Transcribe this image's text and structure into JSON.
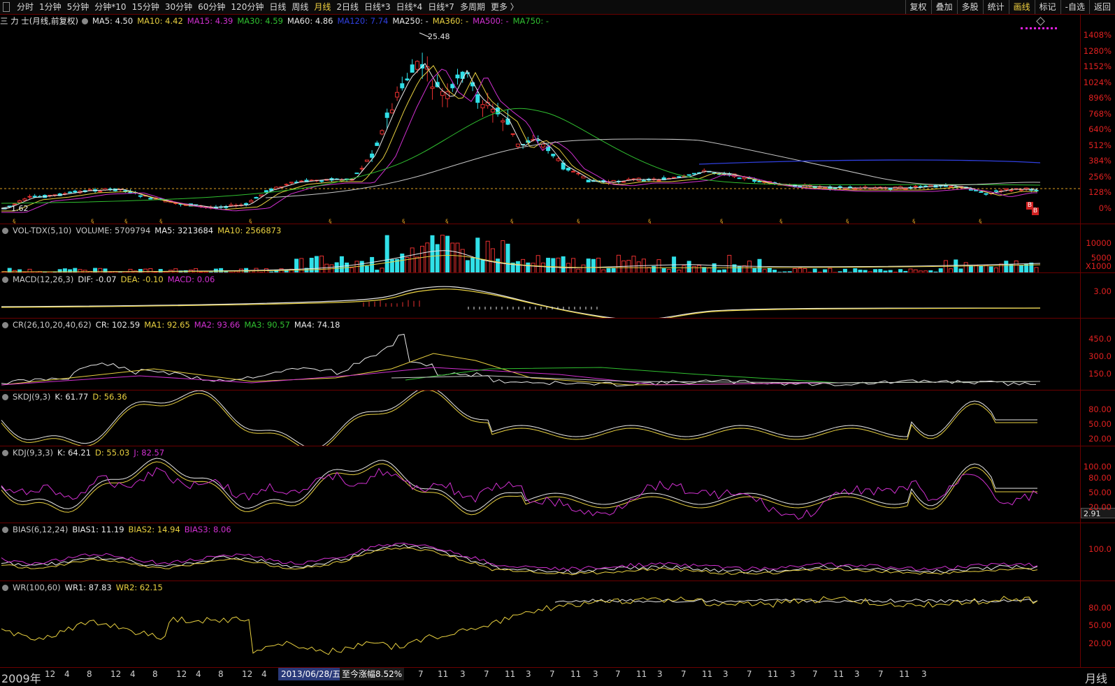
{
  "toolbar": {
    "periods": [
      "分时",
      "1分钟",
      "5分钟",
      "分钟*10",
      "15分钟",
      "30分钟",
      "60分钟",
      "120分钟",
      "日线",
      "周线",
      "月线",
      "2日线",
      "日线*3",
      "日线*4",
      "日线*7",
      "多周期",
      "更多 〉"
    ],
    "active_period": "月线",
    "right": [
      "复权",
      "叠加",
      "多股",
      "统计",
      "画线",
      "标记",
      "-自选",
      "返回"
    ],
    "right_active": "画线"
  },
  "main": {
    "title": "三 力 士(月线,前复权)",
    "ma": [
      {
        "label": "MA5: 4.50",
        "color": "#e8e8e8"
      },
      {
        "label": "MA10: 4.42",
        "color": "#e8d040"
      },
      {
        "label": "MA15: 4.39",
        "color": "#d030d0"
      },
      {
        "label": "MA30: 4.59",
        "color": "#30c030"
      },
      {
        "label": "MA60: 4.86",
        "color": "#e8e8e8"
      },
      {
        "label": "MA120: 7.74",
        "color": "#3040e0"
      },
      {
        "label": "MA250: -",
        "color": "#e8e8e8"
      },
      {
        "label": "MA360: -",
        "color": "#e8d040"
      },
      {
        "label": "MA500: -",
        "color": "#d030d0"
      },
      {
        "label": "MA750: -",
        "color": "#30c030"
      }
    ],
    "high_label": "25.48",
    "low_label": "1.62",
    "axis": [
      "1408%",
      "1280%",
      "1152%",
      "1024%",
      "896%",
      "768%",
      "640%",
      "512%",
      "384%",
      "256%",
      "128%",
      "0%"
    ],
    "buy_marks": [
      "B",
      "B"
    ]
  },
  "vol": {
    "legend": [
      {
        "label": "VOL-TDX(5,10)",
        "color": "#c8c8c8"
      },
      {
        "label": "VOLUME: 5709794",
        "color": "#c8c8c8"
      },
      {
        "label": "MA5: 3213684",
        "color": "#e8e8e8"
      },
      {
        "label": "MA10: 2566873",
        "color": "#e8d040"
      }
    ],
    "axis": [
      "10000",
      "5000"
    ],
    "unit": "X1000"
  },
  "macd": {
    "legend": [
      {
        "label": "MACD(12,26,3)",
        "color": "#c8c8c8"
      },
      {
        "label": "DIF: -0.07",
        "color": "#e8e8e8"
      },
      {
        "label": "DEA: -0.10",
        "color": "#e8d040"
      },
      {
        "label": "MACD: 0.06",
        "color": "#d030d0"
      }
    ],
    "axis": [
      "3.00"
    ]
  },
  "cr": {
    "legend": [
      {
        "label": "CR(26,10,20,40,62)",
        "color": "#c8c8c8"
      },
      {
        "label": "CR: 102.59",
        "color": "#e8e8e8"
      },
      {
        "label": "MA1: 92.65",
        "color": "#e8d040"
      },
      {
        "label": "MA2: 93.66",
        "color": "#d030d0"
      },
      {
        "label": "MA3: 90.57",
        "color": "#30c030"
      },
      {
        "label": "MA4: 74.18",
        "color": "#e8e8e8"
      }
    ],
    "axis": [
      "450.0",
      "300.0",
      "150.0"
    ]
  },
  "skdj": {
    "legend": [
      {
        "label": "SKDJ(9,3)",
        "color": "#c8c8c8"
      },
      {
        "label": "K: 61.77",
        "color": "#e8e8e8"
      },
      {
        "label": "D: 56.36",
        "color": "#e8d040"
      }
    ],
    "axis": [
      "80.00",
      "50.00",
      "20.00"
    ]
  },
  "kdj": {
    "legend": [
      {
        "label": "KDJ(9,3,3)",
        "color": "#c8c8c8"
      },
      {
        "label": "K: 64.21",
        "color": "#e8e8e8"
      },
      {
        "label": "D: 55.03",
        "color": "#e8d040"
      },
      {
        "label": "J: 82.57",
        "color": "#d030d0"
      }
    ],
    "axis": [
      "100.00",
      "80.00",
      "50.00",
      "20.00"
    ],
    "readout": "2.91"
  },
  "bias": {
    "legend": [
      {
        "label": "BIAS(6,12,24)",
        "color": "#c8c8c8"
      },
      {
        "label": "BIAS1: 11.19",
        "color": "#e8e8e8"
      },
      {
        "label": "BIAS2: 14.94",
        "color": "#e8d040"
      },
      {
        "label": "BIAS3: 8.06",
        "color": "#d030d0"
      }
    ],
    "axis": [
      "100.0"
    ]
  },
  "wr": {
    "legend": [
      {
        "label": "WR(100,60)",
        "color": "#c8c8c8"
      },
      {
        "label": "WR1: 87.83",
        "color": "#e8e8e8"
      },
      {
        "label": "WR2: 62.15",
        "color": "#e8d040"
      }
    ],
    "axis": [
      "80.00",
      "50.00",
      "20.00"
    ]
  },
  "bottom": {
    "year": "2009年",
    "months": [
      "12",
      "4",
      "8",
      "12",
      "4",
      "8",
      "12",
      "4",
      "8",
      "12",
      "4",
      "8",
      "12",
      "4",
      "8",
      "11",
      "3",
      "7",
      "11",
      "3",
      "7",
      "11",
      "3",
      "7",
      "11",
      "3",
      "7",
      "11",
      "3",
      "7",
      "11",
      "3",
      "7",
      "11",
      "3",
      "7",
      "11",
      "3",
      "7",
      "11",
      "3"
    ],
    "date": "2013/06/28/五",
    "gain": "至今涨幅8.52%",
    "period": "月线"
  }
}
